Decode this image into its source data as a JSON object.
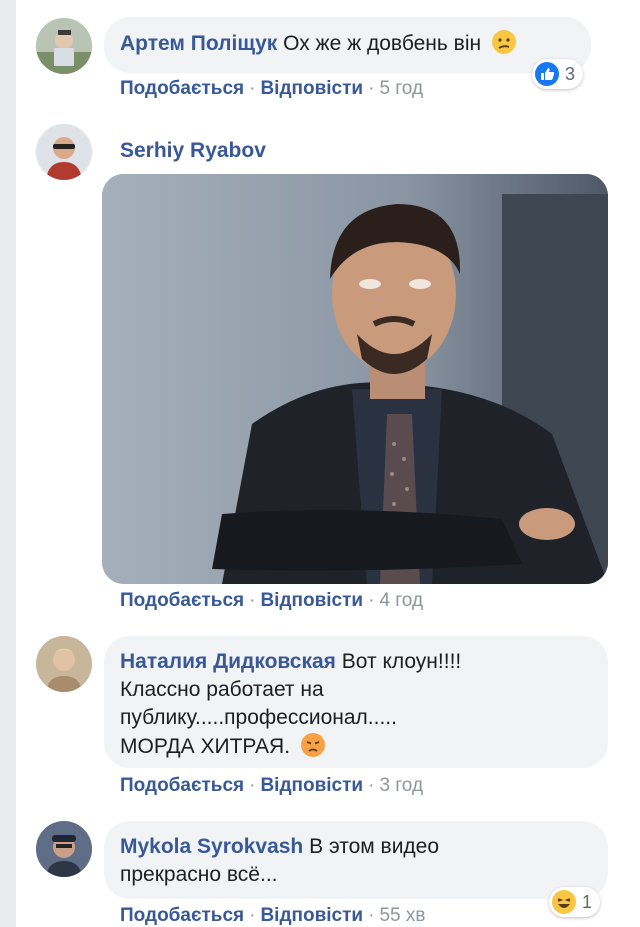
{
  "comments": [
    {
      "author": "Артем Поліщук",
      "text": "Ох же ж довбень він",
      "emoji_icon": "confused-face-icon",
      "actions": {
        "like": "Подобається",
        "reply": "Відповісти",
        "time": "5 год"
      },
      "reaction": {
        "icon": "like-icon",
        "count": "3"
      }
    },
    {
      "author": "Serhiy Ryabov",
      "attachment_icon": "eye-roll-meme-image",
      "actions": {
        "like": "Подобається",
        "reply": "Відповісти",
        "time": "4 год"
      }
    },
    {
      "author": "Наталия Дидковская",
      "text_lines": [
        "Вот клоун!!!!",
        "Классно работает на",
        "публику.....профессионал.....",
        "МОРДА ХИТРАЯ."
      ],
      "emoji_icon": "pouting-face-icon",
      "actions": {
        "like": "Подобається",
        "reply": "Відповісти",
        "time": "3 год"
      }
    },
    {
      "author": "Mykola Syrokvash",
      "text_lines": [
        "В этом видео",
        "прекрасно всё..."
      ],
      "actions": {
        "like": "Подобається",
        "reply": "Відповісти",
        "time": "55 хв"
      },
      "reaction": {
        "icon": "haha-icon",
        "count": "1"
      }
    }
  ],
  "colors": {
    "link": "#385898",
    "meta": "#90949c",
    "bubble": "#f2f3f5",
    "like_blue": "#1877f2",
    "emoji_yellow": "#f7c744"
  }
}
